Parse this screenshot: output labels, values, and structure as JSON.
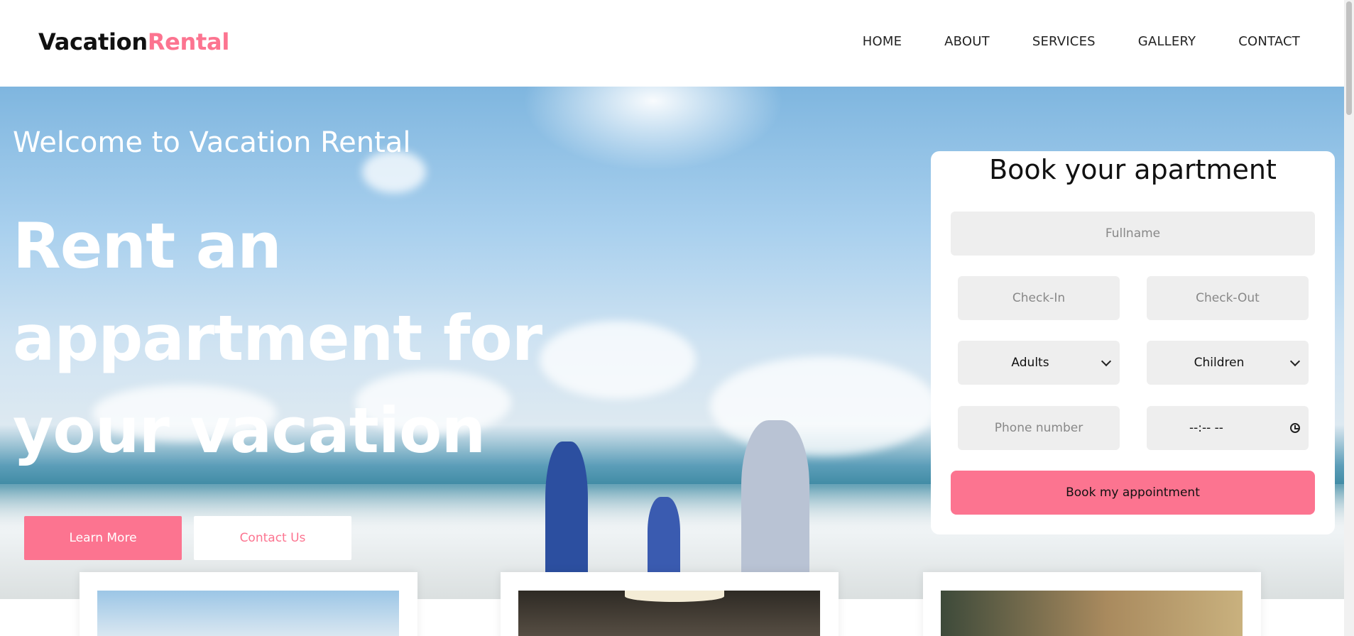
{
  "brand": {
    "part1": "Vacation",
    "part2": "Rental",
    "accent_color": "#fc7490"
  },
  "nav": {
    "items": [
      {
        "label": "HOME"
      },
      {
        "label": "ABOUT"
      },
      {
        "label": "SERVICES"
      },
      {
        "label": "GALLERY"
      },
      {
        "label": "CONTACT"
      }
    ]
  },
  "hero": {
    "welcome": "Welcome to Vacation Rental",
    "headline_lines": [
      "Rent an",
      "appartment for",
      "your vacation"
    ],
    "learn_more_label": "Learn More",
    "contact_label": "Contact Us"
  },
  "booking": {
    "title": "Book your apartment",
    "fullname_placeholder": "Fullname",
    "checkin_placeholder": "Check-In",
    "checkout_placeholder": "Check-Out",
    "adults_selected": "Adults",
    "children_selected": "Children",
    "phone_placeholder": "Phone number",
    "time_value": "--:-- --",
    "submit_label": "Book my appointment"
  },
  "icons": {
    "adults_dropdown": "chevron-down-icon",
    "children_dropdown": "chevron-down-icon",
    "time_picker": "clock-icon"
  }
}
